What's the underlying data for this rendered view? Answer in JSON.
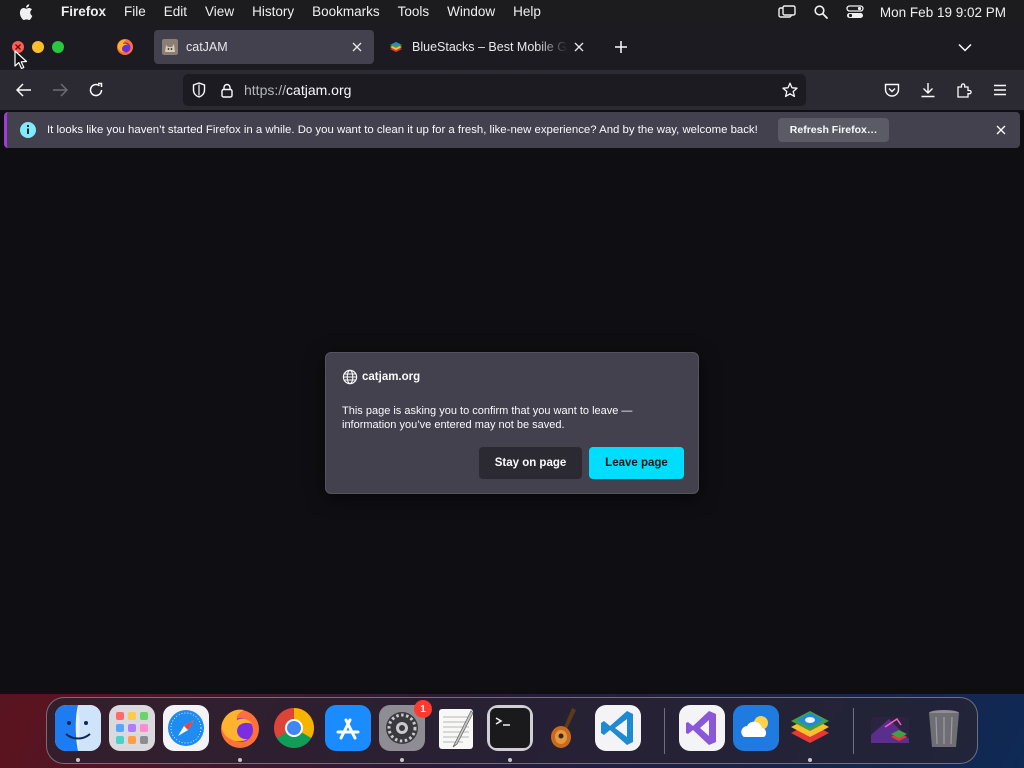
{
  "menubar": {
    "app_name": "Firefox",
    "menus": [
      "File",
      "Edit",
      "View",
      "History",
      "Bookmarks",
      "Tools",
      "Window",
      "Help"
    ],
    "clock": "Mon Feb 19  9:02 PM"
  },
  "tabs": [
    {
      "title": "catJAM",
      "active": true
    },
    {
      "title": "BlueStacks – Best Mobile Gaming Platform",
      "active": false
    }
  ],
  "urlbar": {
    "protocol": "https://",
    "host": "catjam.org"
  },
  "notification": {
    "message": "It looks like you haven’t started Firefox in a while. Do you want to clean it up for a fresh, like-new experience? And by the way, welcome back!",
    "button": "Refresh Firefox…"
  },
  "dialog": {
    "site": "catjam.org",
    "text": "This page is asking you to confirm that you want to leave — information you’ve entered may not be saved.",
    "stay_label": "Stay on page",
    "leave_label": "Leave page"
  },
  "dock": {
    "apps": [
      {
        "name": "Finder",
        "icon": "finder-icon",
        "running": true
      },
      {
        "name": "Launchpad",
        "icon": "launchpad-icon",
        "running": false
      },
      {
        "name": "Safari",
        "icon": "safari-icon",
        "running": false
      },
      {
        "name": "Firefox",
        "icon": "firefox-icon",
        "running": true
      },
      {
        "name": "Google Chrome",
        "icon": "chrome-icon",
        "running": false
      },
      {
        "name": "App Store",
        "icon": "app-store-icon",
        "running": false
      },
      {
        "name": "System Settings",
        "icon": "system-settings-icon",
        "running": true,
        "badge": "1"
      },
      {
        "name": "TextEdit",
        "icon": "textedit-icon",
        "running": false
      },
      {
        "name": "Terminal",
        "icon": "terminal-icon",
        "running": true
      },
      {
        "name": "GarageBand",
        "icon": "garageband-icon",
        "running": false
      },
      {
        "name": "Visual Studio Code",
        "icon": "vscode-icon",
        "running": false
      },
      {
        "name": "Visual Studio",
        "icon": "visual-studio-icon",
        "running": false
      },
      {
        "name": "Weather",
        "icon": "weather-icon",
        "running": false
      },
      {
        "name": "BlueStacks",
        "icon": "bluestacks-icon",
        "running": true
      },
      {
        "name": "Downloads",
        "icon": "downloads-stack-icon",
        "running": false
      },
      {
        "name": "Trash",
        "icon": "trash-icon",
        "running": false
      }
    ]
  },
  "colors": {
    "accent": "#00ddff",
    "toolbar": "#2b2a33",
    "tab_active": "#42414d",
    "dialog_bg": "#42414d",
    "page_bg": "#0f0e12"
  }
}
